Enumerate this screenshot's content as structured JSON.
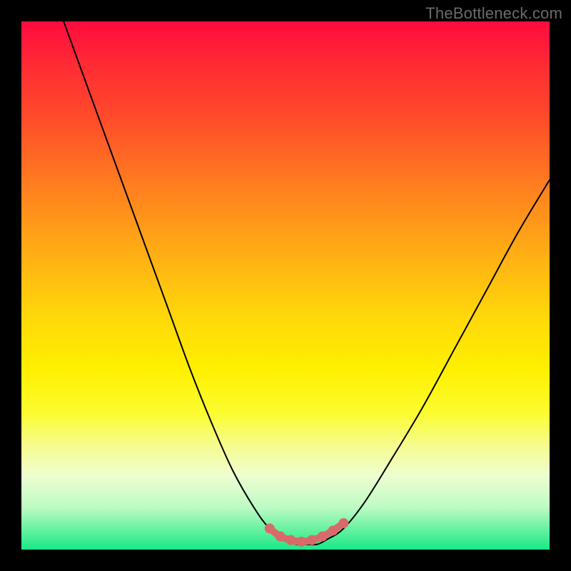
{
  "watermark": {
    "text": "TheBottleneck.com"
  },
  "chart_data": {
    "type": "line",
    "title": "",
    "xlabel": "",
    "ylabel": "",
    "xlim": [
      0,
      100
    ],
    "ylim": [
      0,
      100
    ],
    "series": [
      {
        "name": "bottleneck-curve",
        "x": [
          8,
          12,
          16,
          20,
          24,
          28,
          32,
          36,
          40,
          44,
          47,
          50,
          52,
          54,
          56,
          58,
          61,
          65,
          70,
          76,
          82,
          88,
          94,
          100
        ],
        "y": [
          100,
          89,
          78,
          67,
          56,
          45,
          34,
          24,
          15,
          8,
          4,
          2,
          1,
          1,
          1,
          2,
          4,
          9,
          17,
          27,
          38,
          49,
          60,
          70
        ]
      }
    ],
    "highlight": {
      "name": "bottom-dots",
      "color": "#d86a6a",
      "points": [
        {
          "x": 47,
          "y": 4
        },
        {
          "x": 49,
          "y": 2.5
        },
        {
          "x": 51,
          "y": 1.8
        },
        {
          "x": 53,
          "y": 1.5
        },
        {
          "x": 55,
          "y": 1.8
        },
        {
          "x": 57,
          "y": 2.5
        },
        {
          "x": 59,
          "y": 3.6
        },
        {
          "x": 61,
          "y": 5.0
        }
      ]
    }
  }
}
